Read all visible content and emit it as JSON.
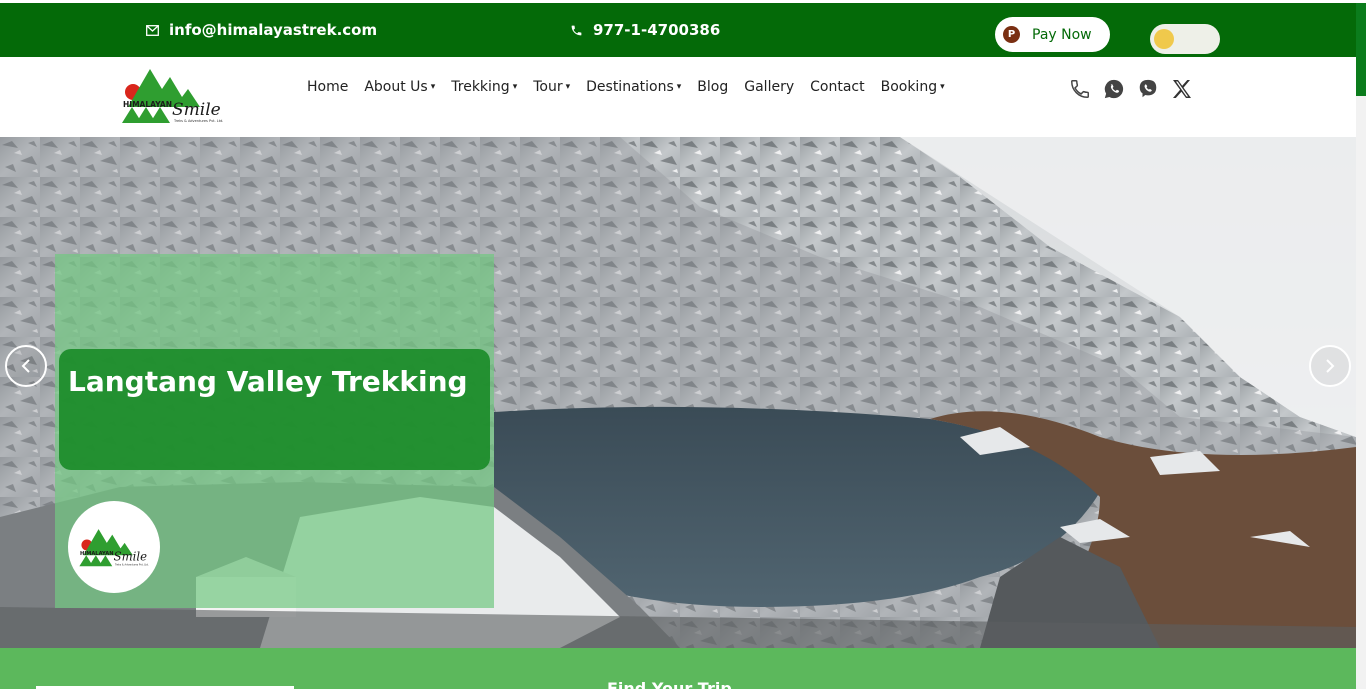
{
  "topbar": {
    "email": "info@himalayastrek.com",
    "email_icon": "mail-icon",
    "phone": "977-1-4700386",
    "phone_icon": "phone-icon",
    "pay_label": "Pay Now",
    "pay_icon": "payment-p-icon",
    "pay_icon_text": "P",
    "theme_toggle_icon": "theme-toggle"
  },
  "logo": {
    "name": "HIMALAYAN",
    "script": "Smile",
    "tagline": "Treks & Adventures Pvt. Ltd."
  },
  "nav": {
    "items": [
      {
        "label": "Home",
        "dropdown": false
      },
      {
        "label": "About Us",
        "dropdown": true
      },
      {
        "label": "Trekking",
        "dropdown": true
      },
      {
        "label": "Tour",
        "dropdown": true
      },
      {
        "label": "Destinations",
        "dropdown": true
      },
      {
        "label": "Blog",
        "dropdown": false
      },
      {
        "label": "Gallery",
        "dropdown": false
      },
      {
        "label": "Contact",
        "dropdown": false
      },
      {
        "label": "Booking",
        "dropdown": true
      }
    ],
    "chevron": "▾"
  },
  "socials": [
    "phone-icon",
    "whatsapp-icon",
    "viber-icon",
    "x-twitter-icon"
  ],
  "hero": {
    "title": "Langtang Valley Trekking",
    "prev_icon": "chevron-left-icon",
    "next_icon": "chevron-right-icon"
  },
  "band": {
    "label": "Find Your Trip"
  },
  "colors": {
    "topbar": "#046a08",
    "accent_green": "#1c8c2a",
    "band_green": "#5cb85c",
    "toggle_knob": "#f0c94c"
  }
}
